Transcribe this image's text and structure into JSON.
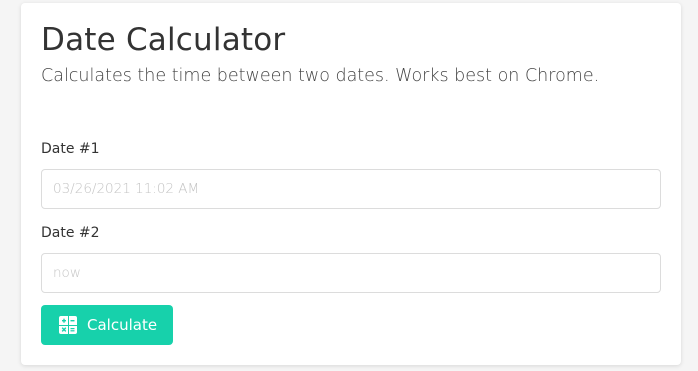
{
  "page": {
    "title": "Date Calculator",
    "subtitle": "Calculates the time between two dates. Works best on Chrome."
  },
  "form": {
    "date1": {
      "label": "Date #1",
      "placeholder": "03/26/2021 11:02 AM",
      "value": ""
    },
    "date2": {
      "label": "Date #2",
      "placeholder": "now",
      "value": ""
    },
    "calculate_button": {
      "label": "Calculate",
      "icon": "calculator-icon"
    }
  },
  "colors": {
    "accent": "#17d1ab",
    "background": "#f5f5f5",
    "card": "#ffffff",
    "text": "#333333"
  }
}
